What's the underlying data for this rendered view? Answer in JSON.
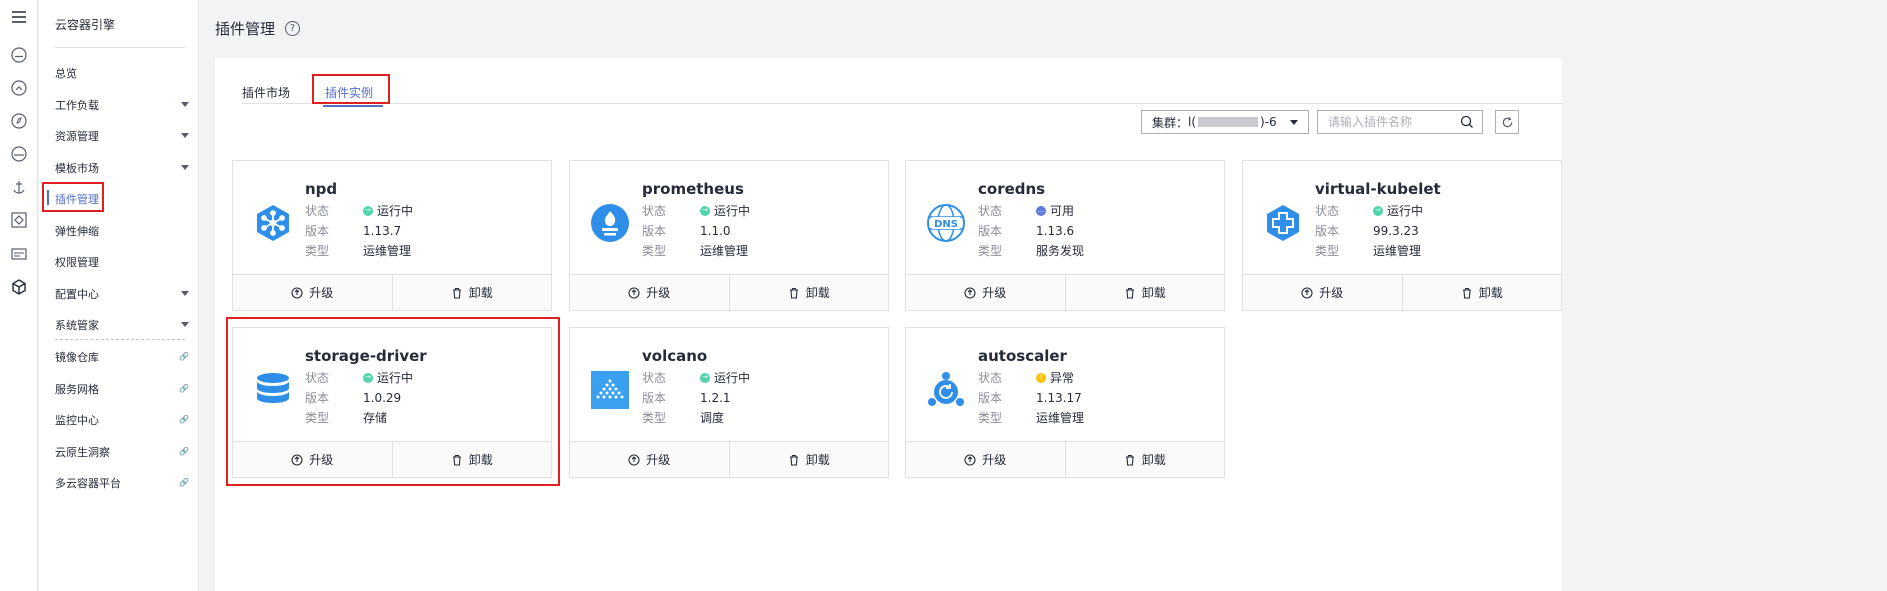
{
  "rail": {
    "icons": [
      "menu-icon",
      "cloud-icon",
      "cloud-sync-icon",
      "compass-icon",
      "cloud-service-icon",
      "anchor-icon",
      "diamond-icon",
      "card-icon",
      "cube-icon"
    ]
  },
  "sidebar": {
    "title": "云容器引擎",
    "items": [
      {
        "label": "总览",
        "caret": false,
        "link": false
      },
      {
        "label": "工作负载",
        "caret": true,
        "link": false
      },
      {
        "label": "资源管理",
        "caret": true,
        "link": false
      },
      {
        "label": "模板市场",
        "caret": true,
        "link": false
      },
      {
        "label": "插件管理",
        "caret": false,
        "link": false,
        "active": true
      },
      {
        "label": "弹性伸缩",
        "caret": false,
        "link": false
      },
      {
        "label": "权限管理",
        "caret": false,
        "link": false
      },
      {
        "label": "配置中心",
        "caret": true,
        "link": false
      },
      {
        "label": "系统管家",
        "caret": true,
        "link": false
      },
      {
        "label": "镜像仓库",
        "caret": false,
        "link": true
      },
      {
        "label": "服务网格",
        "caret": false,
        "link": true
      },
      {
        "label": "监控中心",
        "caret": false,
        "link": true
      },
      {
        "label": "云原生洞察",
        "caret": false,
        "link": true
      },
      {
        "label": "多云容器平台",
        "caret": false,
        "link": true
      }
    ]
  },
  "header": {
    "title": "插件管理",
    "help": "?"
  },
  "tabs": [
    {
      "label": "插件市场",
      "active": false
    },
    {
      "label": "插件实例",
      "active": true
    }
  ],
  "toolbar": {
    "cluster_label": "集群：",
    "cluster_prefix": "l(",
    "cluster_suffix": ")-6",
    "search_placeholder": "请输入插件名称"
  },
  "labels": {
    "status": "状态",
    "version": "版本",
    "type": "类型",
    "upgrade": "升级",
    "uninstall": "卸载"
  },
  "colors": {
    "accent": "#526ecc",
    "running": "#50d4ab",
    "available": "#5e7ce0",
    "abnormal": "#fac20a",
    "highlight": "#e02020",
    "logo": "#3aa0f0"
  },
  "cards": [
    {
      "name": "npd",
      "status": "运行中",
      "status_color": "green",
      "version": "1.13.7",
      "type": "运维管理",
      "logo": "npd-hexagon-icon"
    },
    {
      "name": "prometheus",
      "status": "运行中",
      "status_color": "green",
      "version": "1.1.0",
      "type": "运维管理",
      "logo": "prometheus-flame-icon"
    },
    {
      "name": "coredns",
      "status": "可用",
      "status_color": "blue",
      "version": "1.13.6",
      "type": "服务发现",
      "logo": "dns-globe-icon"
    },
    {
      "name": "virtual-kubelet",
      "status": "运行中",
      "status_color": "green",
      "version": "99.3.23",
      "type": "运维管理",
      "logo": "cross-hexagon-icon"
    },
    {
      "name": "storage-driver",
      "status": "运行中",
      "status_color": "green",
      "version": "1.0.29",
      "type": "存储",
      "logo": "database-icon"
    },
    {
      "name": "volcano",
      "status": "运行中",
      "status_color": "green",
      "version": "1.2.1",
      "type": "调度",
      "logo": "volcano-icon"
    },
    {
      "name": "autoscaler",
      "status": "异常",
      "status_color": "yellow",
      "version": "1.13.17",
      "type": "运维管理",
      "logo": "autoscaler-icon"
    }
  ]
}
